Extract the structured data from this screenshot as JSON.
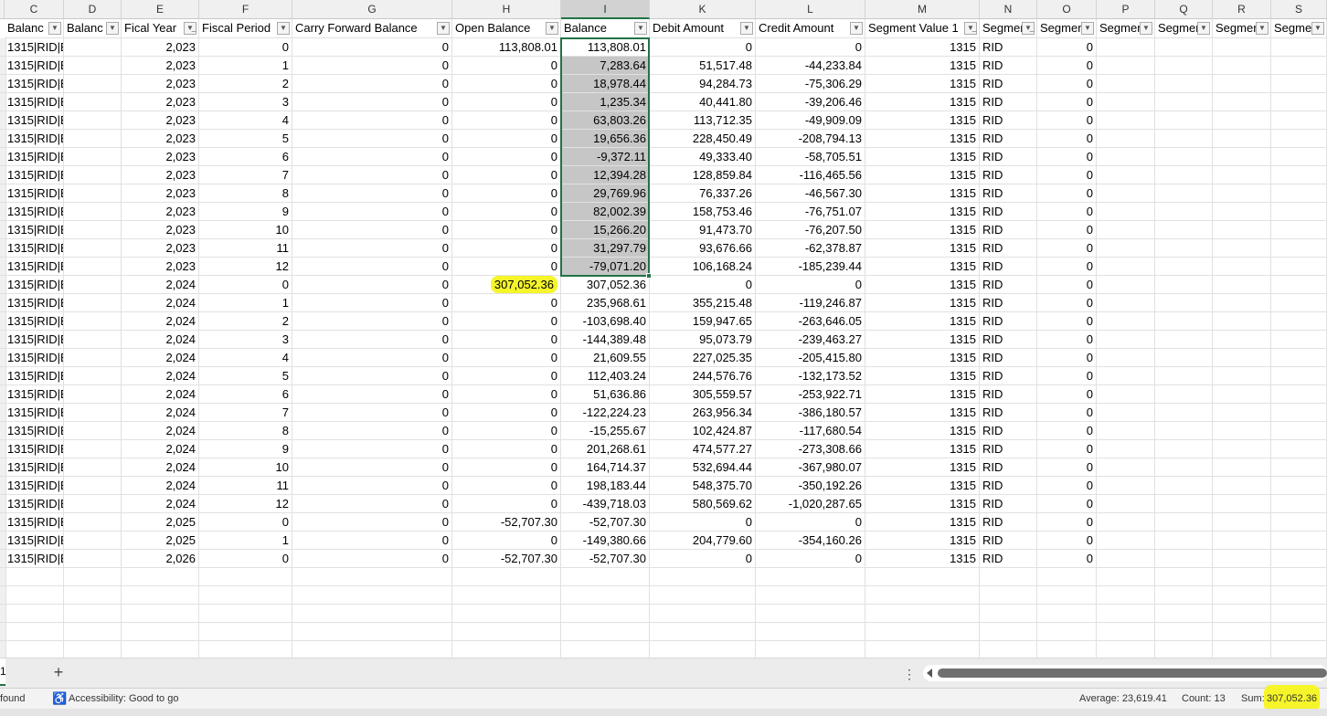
{
  "columns": [
    {
      "letter": "C",
      "header": "Balanc",
      "filter": "dropdown"
    },
    {
      "letter": "D",
      "header": "Balanc",
      "filter": "dropdown"
    },
    {
      "letter": "E",
      "header": "Fical Year",
      "filter": "filtered"
    },
    {
      "letter": "F",
      "header": "Fiscal Period",
      "filter": "dropdown"
    },
    {
      "letter": "G",
      "header": "Carry Forward Balance",
      "filter": "dropdown"
    },
    {
      "letter": "H",
      "header": "Open Balance",
      "filter": "dropdown"
    },
    {
      "letter": "I",
      "header": "Balance",
      "filter": "dropdown"
    },
    {
      "letter": "K",
      "header": "Debit Amount",
      "filter": "dropdown"
    },
    {
      "letter": "L",
      "header": "Credit Amount",
      "filter": "dropdown"
    },
    {
      "letter": "M",
      "header": "Segment Value 1",
      "filter": "filtered"
    },
    {
      "letter": "N",
      "header": "Segmen",
      "filter": "filtered"
    },
    {
      "letter": "O",
      "header": "Segmen",
      "filter": "dropdown"
    },
    {
      "letter": "P",
      "header": "Segmen",
      "filter": "dropdown"
    },
    {
      "letter": "Q",
      "header": "Segmen",
      "filter": "dropdown"
    },
    {
      "letter": "R",
      "header": "Segmen",
      "filter": "dropdown"
    },
    {
      "letter": "S",
      "header": "Segmen",
      "filter": "dropdown"
    }
  ],
  "rows": [
    [
      "1315|RID|B",
      "",
      "2,023",
      "0",
      "0",
      "113,808.01",
      "113,808.01",
      "0",
      "0",
      "1315",
      "RID",
      "0"
    ],
    [
      "1315|RID|B",
      "",
      "2,023",
      "1",
      "0",
      "0",
      "7,283.64",
      "51,517.48",
      "-44,233.84",
      "1315",
      "RID",
      "0"
    ],
    [
      "1315|RID|B",
      "",
      "2,023",
      "2",
      "0",
      "0",
      "18,978.44",
      "94,284.73",
      "-75,306.29",
      "1315",
      "RID",
      "0"
    ],
    [
      "1315|RID|B",
      "",
      "2,023",
      "3",
      "0",
      "0",
      "1,235.34",
      "40,441.80",
      "-39,206.46",
      "1315",
      "RID",
      "0"
    ],
    [
      "1315|RID|B",
      "",
      "2,023",
      "4",
      "0",
      "0",
      "63,803.26",
      "113,712.35",
      "-49,909.09",
      "1315",
      "RID",
      "0"
    ],
    [
      "1315|RID|B",
      "",
      "2,023",
      "5",
      "0",
      "0",
      "19,656.36",
      "228,450.49",
      "-208,794.13",
      "1315",
      "RID",
      "0"
    ],
    [
      "1315|RID|B",
      "",
      "2,023",
      "6",
      "0",
      "0",
      "-9,372.11",
      "49,333.40",
      "-58,705.51",
      "1315",
      "RID",
      "0"
    ],
    [
      "1315|RID|B",
      "",
      "2,023",
      "7",
      "0",
      "0",
      "12,394.28",
      "128,859.84",
      "-116,465.56",
      "1315",
      "RID",
      "0"
    ],
    [
      "1315|RID|B",
      "",
      "2,023",
      "8",
      "0",
      "0",
      "29,769.96",
      "76,337.26",
      "-46,567.30",
      "1315",
      "RID",
      "0"
    ],
    [
      "1315|RID|B",
      "",
      "2,023",
      "9",
      "0",
      "0",
      "82,002.39",
      "158,753.46",
      "-76,751.07",
      "1315",
      "RID",
      "0"
    ],
    [
      "1315|RID|B",
      "",
      "2,023",
      "10",
      "0",
      "0",
      "15,266.20",
      "91,473.70",
      "-76,207.50",
      "1315",
      "RID",
      "0"
    ],
    [
      "1315|RID|B",
      "",
      "2,023",
      "11",
      "0",
      "0",
      "31,297.79",
      "93,676.66",
      "-62,378.87",
      "1315",
      "RID",
      "0"
    ],
    [
      "1315|RID|B",
      "",
      "2,023",
      "12",
      "0",
      "0",
      "-79,071.20",
      "106,168.24",
      "-185,239.44",
      "1315",
      "RID",
      "0"
    ],
    [
      "1315|RID|B",
      "",
      "2,024",
      "0",
      "0",
      "307,052.36",
      "307,052.36",
      "0",
      "0",
      "1315",
      "RID",
      "0"
    ],
    [
      "1315|RID|B",
      "",
      "2,024",
      "1",
      "0",
      "0",
      "235,968.61",
      "355,215.48",
      "-119,246.87",
      "1315",
      "RID",
      "0"
    ],
    [
      "1315|RID|B",
      "",
      "2,024",
      "2",
      "0",
      "0",
      "-103,698.40",
      "159,947.65",
      "-263,646.05",
      "1315",
      "RID",
      "0"
    ],
    [
      "1315|RID|B",
      "",
      "2,024",
      "3",
      "0",
      "0",
      "-144,389.48",
      "95,073.79",
      "-239,463.27",
      "1315",
      "RID",
      "0"
    ],
    [
      "1315|RID|B",
      "",
      "2,024",
      "4",
      "0",
      "0",
      "21,609.55",
      "227,025.35",
      "-205,415.80",
      "1315",
      "RID",
      "0"
    ],
    [
      "1315|RID|B",
      "",
      "2,024",
      "5",
      "0",
      "0",
      "112,403.24",
      "244,576.76",
      "-132,173.52",
      "1315",
      "RID",
      "0"
    ],
    [
      "1315|RID|B",
      "",
      "2,024",
      "6",
      "0",
      "0",
      "51,636.86",
      "305,559.57",
      "-253,922.71",
      "1315",
      "RID",
      "0"
    ],
    [
      "1315|RID|B",
      "",
      "2,024",
      "7",
      "0",
      "0",
      "-122,224.23",
      "263,956.34",
      "-386,180.57",
      "1315",
      "RID",
      "0"
    ],
    [
      "1315|RID|B",
      "",
      "2,024",
      "8",
      "0",
      "0",
      "-15,255.67",
      "102,424.87",
      "-117,680.54",
      "1315",
      "RID",
      "0"
    ],
    [
      "1315|RID|B",
      "",
      "2,024",
      "9",
      "0",
      "0",
      "201,268.61",
      "474,577.27",
      "-273,308.66",
      "1315",
      "RID",
      "0"
    ],
    [
      "1315|RID|B",
      "",
      "2,024",
      "10",
      "0",
      "0",
      "164,714.37",
      "532,694.44",
      "-367,980.07",
      "1315",
      "RID",
      "0"
    ],
    [
      "1315|RID|B",
      "",
      "2,024",
      "11",
      "0",
      "0",
      "198,183.44",
      "548,375.70",
      "-350,192.26",
      "1315",
      "RID",
      "0"
    ],
    [
      "1315|RID|B",
      "",
      "2,024",
      "12",
      "0",
      "0",
      "-439,718.03",
      "580,569.62",
      "-1,020,287.65",
      "1315",
      "RID",
      "0"
    ],
    [
      "1315|RID|B",
      "",
      "2,025",
      "0",
      "0",
      "-52,707.30",
      "-52,707.30",
      "0",
      "0",
      "1315",
      "RID",
      "0"
    ],
    [
      "1315|RID|B",
      "",
      "2,025",
      "1",
      "0",
      "0",
      "-149,380.66",
      "204,779.60",
      "-354,160.26",
      "1315",
      "RID",
      "0"
    ],
    [
      "1315|RID|B",
      "",
      "2,026",
      "0",
      "0",
      "-52,707.30",
      "-52,707.30",
      "0",
      "0",
      "1315",
      "RID",
      "0"
    ]
  ],
  "tabs": {
    "current_sheet": "1",
    "add_sheet": "+",
    "more": "⋮"
  },
  "status": {
    "left": "found",
    "accessibility": "Accessibility: Good to go",
    "average": "Average: 23,619.41",
    "count": "Count: 13",
    "sum_label": "Sum:",
    "sum_value": "307,052.36"
  },
  "colors": {
    "selection_border": "#217346",
    "highlight": "#f5f52a"
  }
}
